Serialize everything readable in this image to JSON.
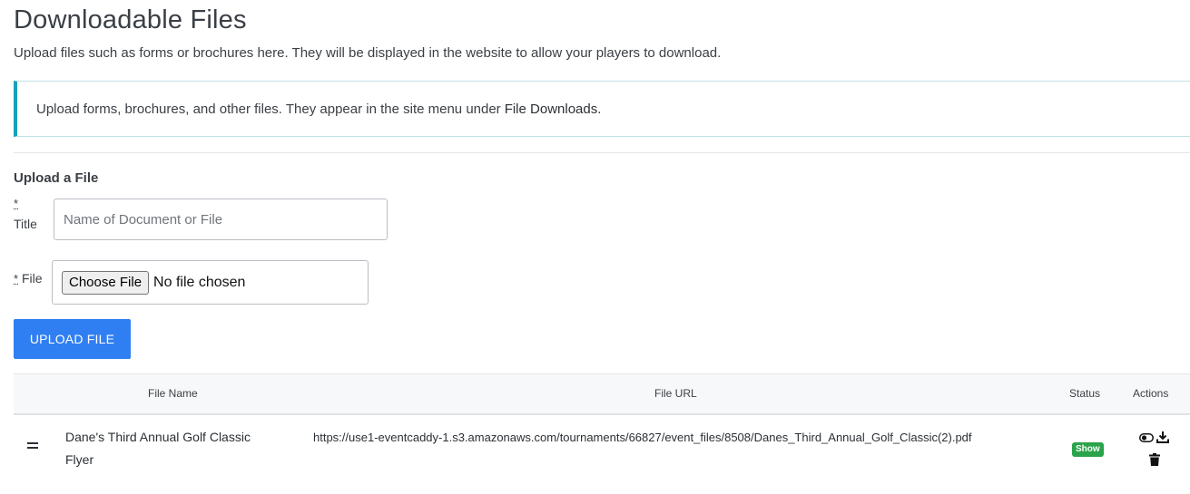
{
  "page": {
    "title": "Downloadable Files",
    "subtitle": "Upload files such as forms or brochures here. They will be displayed in the website to allow your players to download."
  },
  "info": {
    "text": "Upload forms, brochures, and other files. They appear in the site menu under",
    "highlight": "File Downloads."
  },
  "upload_form": {
    "section_title": "Upload a File",
    "required_mark": "*",
    "title_label": "Title",
    "title_placeholder": "Name of Document or File",
    "file_label": "File",
    "choose_file_label": "Choose File",
    "no_file_text": "No file chosen",
    "submit_label": "UPLOAD FILE"
  },
  "table": {
    "columns": [
      "File Name",
      "File URL",
      "Status",
      "Actions"
    ],
    "rows": [
      {
        "file_name": "Dane's Third Annual Golf Classic Flyer",
        "file_url": "https://use1-eventcaddy-1.s3.amazonaws.com/tournaments/66827/event_files/8508/Danes_Third_Annual_Golf_Classic(2).pdf",
        "status": "Show"
      }
    ]
  },
  "colors": {
    "accent": "#2f7ff3",
    "info_border": "#17a2b8",
    "status_show": "#2aa34a"
  }
}
